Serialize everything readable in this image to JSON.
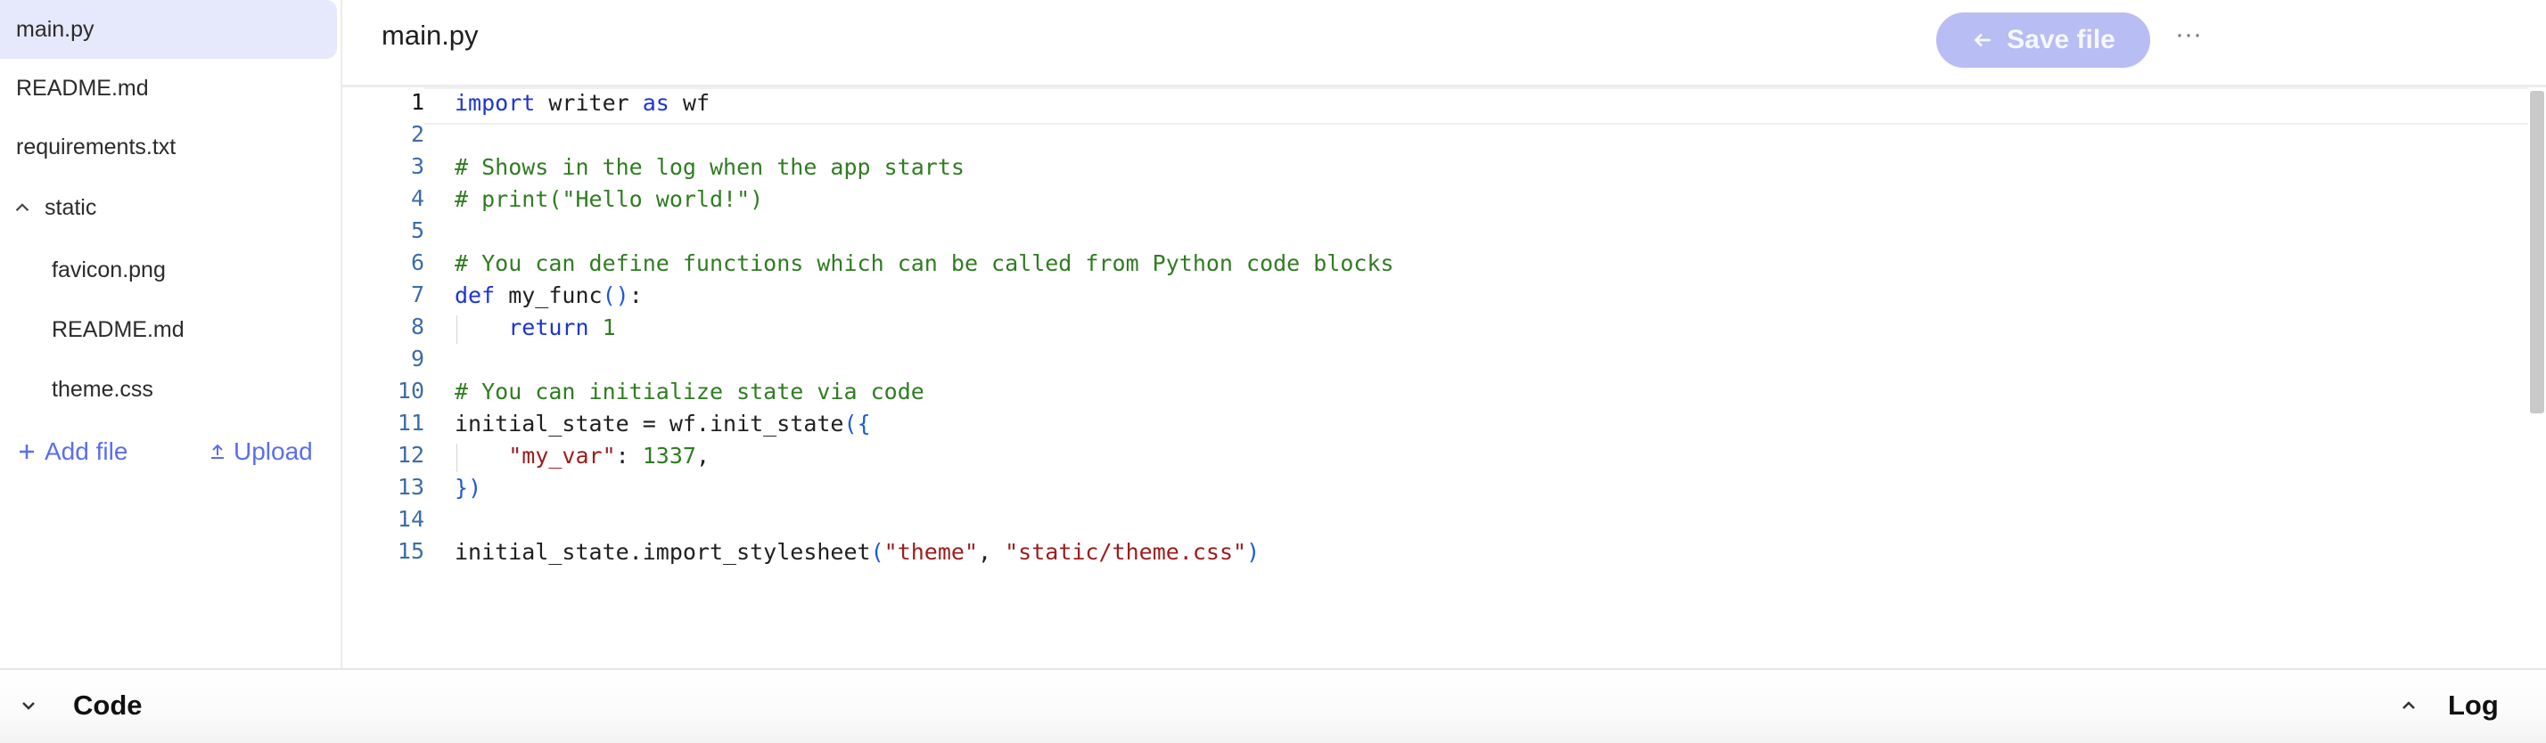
{
  "sidebar": {
    "files": [
      {
        "label": "main.py",
        "active": true
      },
      {
        "label": "README.md",
        "active": false
      },
      {
        "label": "requirements.txt",
        "active": false
      }
    ],
    "folder": {
      "label": "static",
      "expanded": true,
      "children": [
        {
          "label": "favicon.png"
        },
        {
          "label": "README.md"
        },
        {
          "label": "theme.css"
        }
      ]
    },
    "actions": {
      "add_file": "Add file",
      "upload": "Upload"
    }
  },
  "header": {
    "title": "main.py",
    "save_label": "Save file",
    "more_label": "···"
  },
  "editor": {
    "current_line": 1,
    "lines": [
      "import writer as wf",
      "",
      "# Shows in the log when the app starts",
      "# print(\"Hello world!\")",
      "",
      "# You can define functions which can be called from Python code blocks",
      "def my_func():",
      "    return 1",
      "",
      "# You can initialize state via code",
      "initial_state = wf.init_state({",
      "    \"my_var\": 1337,",
      "})",
      "",
      "initial_state.import_stylesheet(\"theme\", \"static/theme.css\")"
    ],
    "line_numbers": [
      "1",
      "2",
      "3",
      "4",
      "5",
      "6",
      "7",
      "8",
      "9",
      "10",
      "11",
      "12",
      "13",
      "14",
      "15"
    ]
  },
  "bottom": {
    "code_label": "Code",
    "log_label": "Log"
  },
  "colors": {
    "accent": "#5a6ef0",
    "save_button": "#b8bdf3",
    "keyword": "#1b34d6",
    "comment": "#2f7d21",
    "string": "#9d1c1c"
  }
}
